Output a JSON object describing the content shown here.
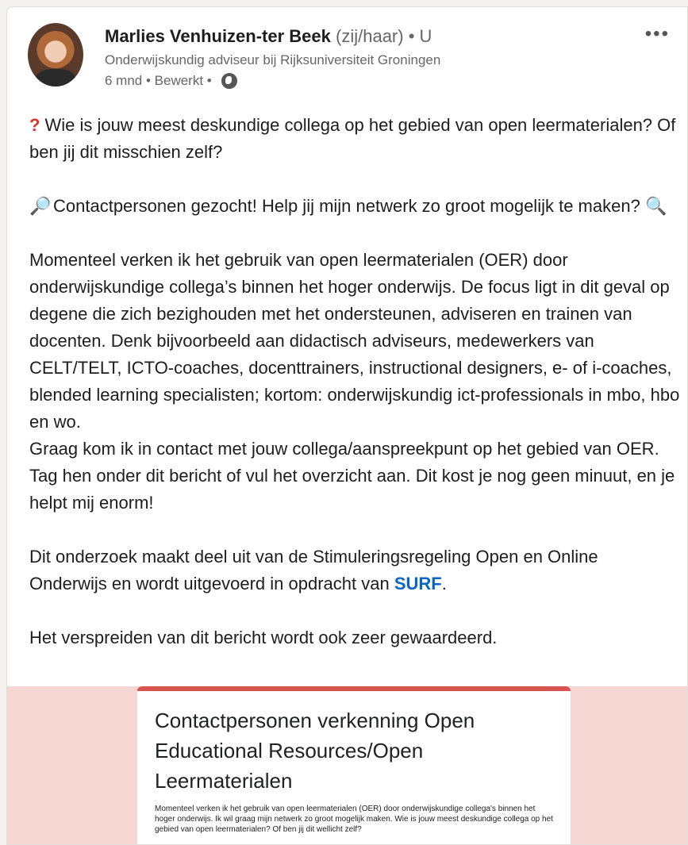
{
  "post": {
    "author": {
      "name": "Marlies Venhuizen-ter Beek",
      "pronouns": "(zij/haar)",
      "degree": "• U",
      "headline": "Onderwijskundig adviseur bij Rijksuniversiteit Groningen",
      "meta": "6 mnd • Bewerkt •",
      "visibility_icon": "globe-icon"
    },
    "more_label": "•••",
    "paragraphs": {
      "p1_icon": "?",
      "p1": "Wie is jouw meest deskundige collega op het gebied van open leermaterialen? Of ben jij dit misschien zelf?",
      "p2_icon_left": "🔎",
      "p2": "Contactpersonen gezocht! Help jij mijn netwerk zo groot mogelijk te maken?",
      "p2_icon_right": "🔍",
      "p3": "Momenteel verken ik het gebruik van open leermaterialen (OER) door onderwijskundige collega’s binnen het hoger onderwijs. De focus ligt in dit geval op degene die zich bezighouden met het ondersteunen, adviseren en trainen van docenten. Denk bijvoorbeeld aan didactisch adviseurs, medewerkers van CELT/TELT, ICTO-coaches, docenttrainers, instructional designers, e- of i-coaches, blended learning specialisten; kortom: onderwijskundig ict-professionals in mbo, hbo en wo.",
      "p4": "Graag kom ik in contact met jouw collega/aanspreekpunt op het gebied van OER. Tag hen onder dit bericht of vul het overzicht aan. Dit kost je nog geen minuut, en je helpt mij enorm!",
      "p5_before": "Dit onderzoek maakt deel uit van de Stimuleringsregeling Open en Online Onderwijs en wordt uitgevoerd in opdracht van",
      "p5_link": "SURF",
      "p5_after": ".",
      "p6": "Het verspreiden van dit bericht wordt ook zeer gewaardeerd."
    },
    "preview": {
      "title": "Contactpersonen verkenning Open Educational Resources/Open Leermaterialen",
      "description": "Momenteel verken ik het gebruik van open leermaterialen (OER) door onderwijskundige collega's binnen het hoger onderwijs. Ik wil graag mijn netwerk zo groot mogelijk maken. Wie is jouw meest deskundige collega op het gebied van open leermaterialen? Of ben jij dit wellicht zelf?"
    },
    "colors": {
      "link": "#0a66c2",
      "preview_bg": "#f6d6d3",
      "form_accent": "#d9534f",
      "question_mark": "#d9342b"
    }
  }
}
